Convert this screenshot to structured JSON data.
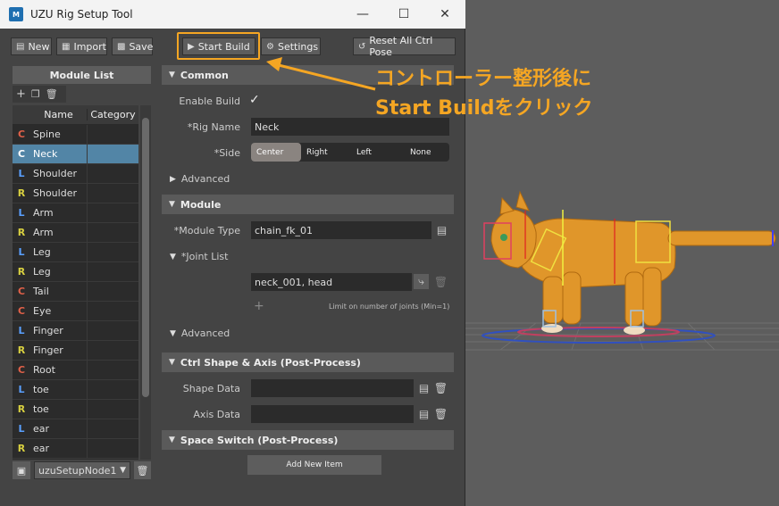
{
  "window": {
    "title": "UZU Rig Setup Tool",
    "app_icon_text": "M"
  },
  "toolbar": {
    "new_label": "New",
    "import_label": "Import",
    "save_label": "Save",
    "start_build_label": "Start Build",
    "settings_label": "Settings",
    "reset_label": "Reset All Ctrl Pose"
  },
  "module_list": {
    "title": "Module List",
    "col_name": "Name",
    "col_category": "Category",
    "rows": [
      {
        "side": "C",
        "name": "Spine",
        "color": "#e06048"
      },
      {
        "side": "C",
        "name": "Neck",
        "color": "#ffffff",
        "selected": true
      },
      {
        "side": "L",
        "name": "Shoulder",
        "color": "#5aa0ff"
      },
      {
        "side": "R",
        "name": "Shoulder",
        "color": "#d8d040"
      },
      {
        "side": "L",
        "name": "Arm",
        "color": "#5aa0ff"
      },
      {
        "side": "R",
        "name": "Arm",
        "color": "#d8d040"
      },
      {
        "side": "L",
        "name": "Leg",
        "color": "#5aa0ff"
      },
      {
        "side": "R",
        "name": "Leg",
        "color": "#d8d040"
      },
      {
        "side": "C",
        "name": "Tail",
        "color": "#e06048"
      },
      {
        "side": "C",
        "name": "Eye",
        "color": "#e06048"
      },
      {
        "side": "L",
        "name": "Finger",
        "color": "#5aa0ff"
      },
      {
        "side": "R",
        "name": "Finger",
        "color": "#d8d040"
      },
      {
        "side": "C",
        "name": "Root",
        "color": "#e06048"
      },
      {
        "side": "L",
        "name": "toe",
        "color": "#5aa0ff"
      },
      {
        "side": "R",
        "name": "toe",
        "color": "#d8d040"
      },
      {
        "side": "L",
        "name": "ear",
        "color": "#5aa0ff"
      },
      {
        "side": "R",
        "name": "ear",
        "color": "#d8d040"
      }
    ],
    "node_select": "uzuSetupNode1"
  },
  "common": {
    "title": "Common",
    "enable_build_label": "Enable Build",
    "rig_name_label": "*Rig Name",
    "rig_name_value": "Neck",
    "side_label": "*Side",
    "side_options": [
      "Center",
      "Right",
      "Left",
      "None"
    ],
    "side_selected": "Center",
    "advanced_label": "Advanced"
  },
  "module": {
    "title": "Module",
    "module_type_label": "*Module Type",
    "module_type_value": "chain_fk_01",
    "joint_list_label": "*Joint List",
    "joint_value": "neck_001, head",
    "limit_text": "Limit on number of joints (Min=1)",
    "advanced_label": "Advanced"
  },
  "ctrl_shape": {
    "title": "Ctrl Shape & Axis (Post-Process)",
    "shape_data_label": "Shape Data",
    "axis_data_label": "Axis Data"
  },
  "space_switch": {
    "title": "Space Switch (Post-Process)",
    "add_item_label": "Add New Item"
  },
  "annotation": {
    "line1": "コントローラー整形後に",
    "line2": "Start Buildをクリック",
    "color": "#f5a623"
  }
}
